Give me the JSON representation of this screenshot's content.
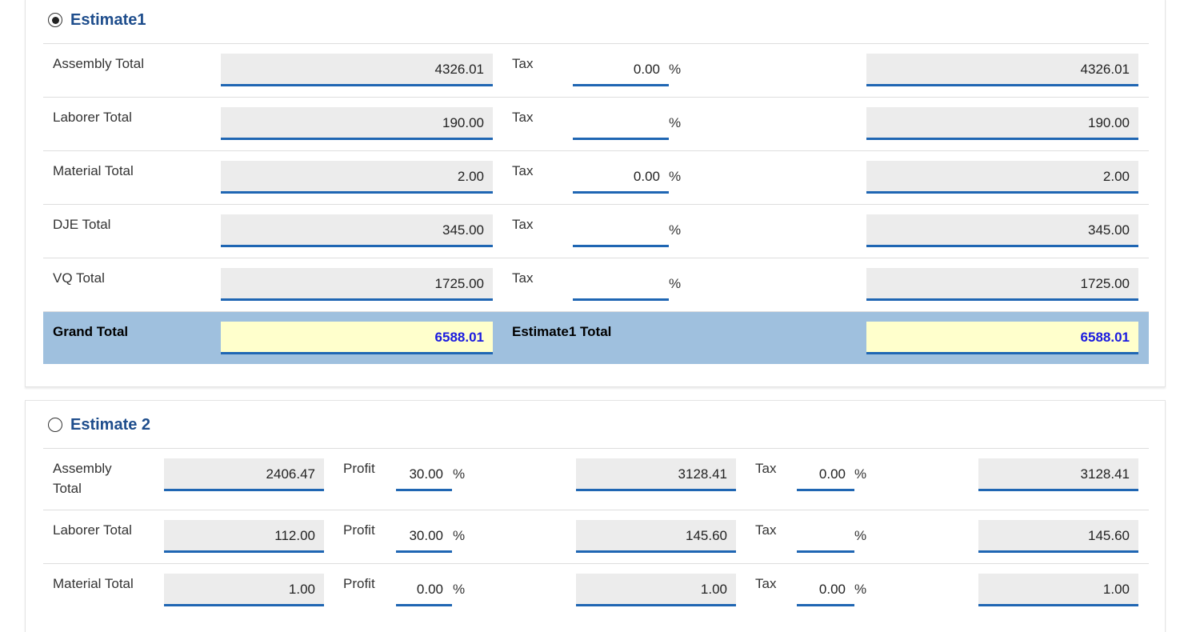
{
  "estimate1": {
    "title": "Estimate1",
    "selected": true,
    "rows": [
      {
        "label": "Assembly Total",
        "amount": "4326.01",
        "tax_label": "Tax",
        "tax": "0.00",
        "pct": "%",
        "total": "4326.01"
      },
      {
        "label": "Laborer Total",
        "amount": "190.00",
        "tax_label": "Tax",
        "tax": "",
        "pct": "%",
        "total": "190.00"
      },
      {
        "label": "Material Total",
        "amount": "2.00",
        "tax_label": "Tax",
        "tax": "0.00",
        "pct": "%",
        "total": "2.00"
      },
      {
        "label": "DJE Total",
        "amount": "345.00",
        "tax_label": "Tax",
        "tax": "",
        "pct": "%",
        "total": "345.00"
      },
      {
        "label": "VQ Total",
        "amount": "1725.00",
        "tax_label": "Tax",
        "tax": "",
        "pct": "%",
        "total": "1725.00"
      }
    ],
    "grand": {
      "label": "Grand Total",
      "amount": "6588.01",
      "total_label": "Estimate1 Total",
      "total": "6588.01"
    }
  },
  "estimate2": {
    "title": "Estimate 2",
    "selected": false,
    "rows": [
      {
        "label_line1": "Assembly",
        "label_line2": "Total",
        "amount": "2406.47",
        "profit_label": "Profit",
        "profit": "30.00",
        "pct1": "%",
        "with_profit": "3128.41",
        "tax_label": "Tax",
        "tax": "0.00",
        "pct2": "%",
        "total": "3128.41"
      },
      {
        "label_line1": "Laborer Total",
        "label_line2": "",
        "amount": "112.00",
        "profit_label": "Profit",
        "profit": "30.00",
        "pct1": "%",
        "with_profit": "145.60",
        "tax_label": "Tax",
        "tax": "",
        "pct2": "%",
        "total": "145.60"
      },
      {
        "label_line1": "Material Total",
        "label_line2": "",
        "amount": "1.00",
        "profit_label": "Profit",
        "profit": "0.00",
        "pct1": "%",
        "with_profit": "1.00",
        "tax_label": "Tax",
        "tax": "0.00",
        "pct2": "%",
        "total": "1.00"
      }
    ]
  },
  "colors": {
    "title": "#1e4d8c",
    "underline": "#1f66b3",
    "grand_bg": "#9fc0de",
    "highlight_bg": "#ffffcc",
    "highlight_text": "#1a1ae0"
  }
}
